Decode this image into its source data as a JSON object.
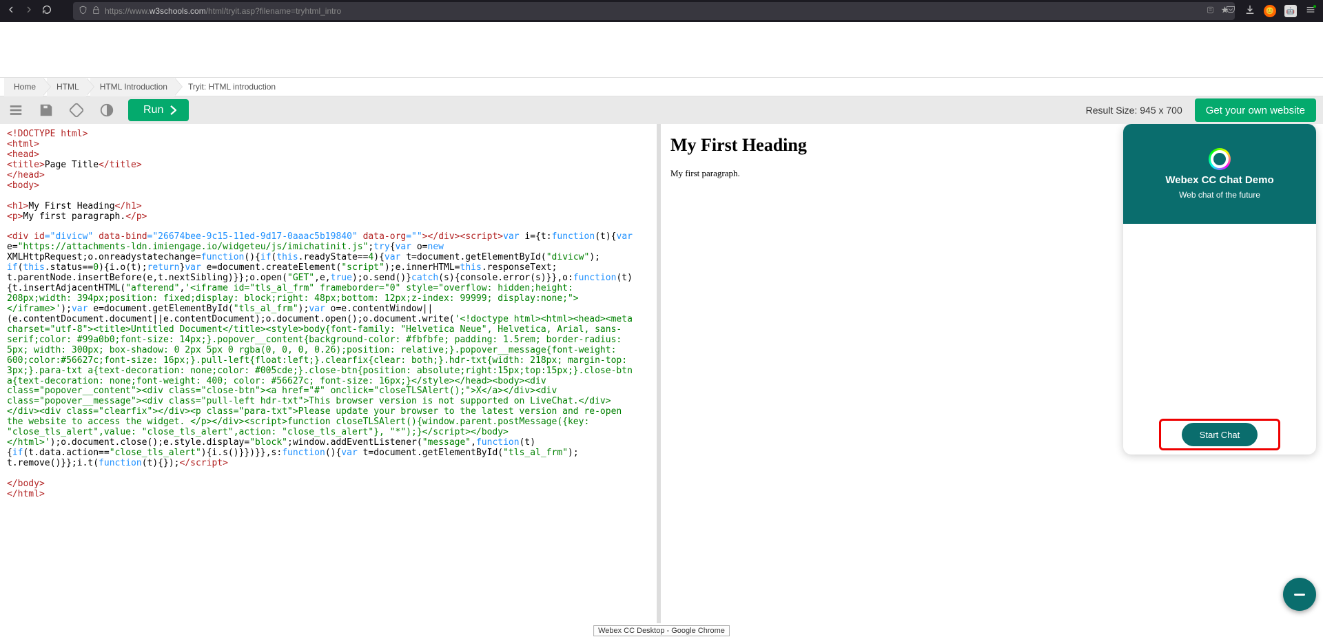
{
  "browser": {
    "url_prefix": "https://www.",
    "url_domain": "w3schools.com",
    "url_path": "/html/tryit.asp?filename=tryhtml_intro"
  },
  "breadcrumbs": {
    "home": "Home",
    "html": "HTML",
    "intro": "HTML Introduction",
    "current": "Tryit: HTML introduction"
  },
  "toolbar": {
    "run": "Run",
    "result_size": "Result Size: 945 x 700",
    "own_site": "Get your own website"
  },
  "preview": {
    "heading": "My First Heading",
    "paragraph": "My first paragraph."
  },
  "chat": {
    "title": "Webex CC Chat Demo",
    "subtitle": "Web chat of the future",
    "start": "Start Chat"
  },
  "bottom_tooltip": "Webex CC Desktop - Google Chrome",
  "code": {
    "l1": "<!DOCTYPE html>",
    "l2": "<html>",
    "l3": "<head>",
    "l4a": "<title>",
    "l4b": "Page Title",
    "l4c": "</title>",
    "l5": "</head>",
    "l6": "<body>",
    "l7a": "<h1>",
    "l7b": "My First Heading",
    "l7c": "</h1>",
    "l8a": "<p>",
    "l8b": "My first paragraph.",
    "l8c": "</p>",
    "div1": "<div id",
    "div1v": "=\"divicw\"",
    "div2": " data-bind",
    "div2v": "=\"26674bee-9c15-11ed-9d17-0aaac5b19840\"",
    "div3": " data-org",
    "div3v": "=\"\"",
    "div4": "></div><script>",
    "div5": "var",
    "div6": " i={t:",
    "div7": "function",
    "div8": "(t){",
    "div9": "var",
    "l10a": "e=",
    "l10b": "\"https://attachments-ldn.imiengage.io/widgeteu/js/imichatinit.js\"",
    "l10c": ";",
    "l10d": "try",
    "l10e": "{",
    "l10f": "var",
    "l10g": " o=",
    "l10h": "new",
    "l11a": "XMLHttpRequest;o.onreadystatechange=",
    "l11b": "function",
    "l11c": "(){",
    "l11d": "if",
    "l11e": "(",
    "l11f": "this",
    "l11g": ".readyState==",
    "l11h": "4",
    "l11i": "){",
    "l11j": "var",
    "l11k": " t=document.getElementById(",
    "l11l": "\"divicw\"",
    "l11m": ");",
    "l12a": "if",
    "l12b": "(",
    "l12c": "this",
    "l12d": ".status==",
    "l12e": "0",
    "l12f": "){i.o(t);",
    "l12g": "return",
    "l12h": "}",
    "l12i": "var",
    "l12j": " e=document.createElement(",
    "l12k": "\"script\"",
    "l12l": ");e.innerHTML=",
    "l12m": "this",
    "l12n": ".responseText;",
    "l13a": "t.parentNode.insertBefore(e,t.nextSibling)}};o.open(",
    "l13b": "\"GET\"",
    "l13c": ",e,",
    "l13d": "true",
    "l13e": ");o.send()}",
    "l13f": "catch",
    "l13g": "(s){console.error(s)}},o:",
    "l13h": "function",
    "l13i": "(t)",
    "l14a": "{t.insertAdjacentHTML(",
    "l14b": "\"afterend\"",
    "l14c": ",",
    "l14d": "'<iframe id=\"tls_al_frm\" frameborder=\"0\" style=\"overflow: hidden;height:",
    "l15": "208px;width: 394px;position: fixed;display: block;right: 48px;bottom: 12px;z-index: 99999; display:none;\">",
    "l16a": "</iframe>'",
    "l16b": ");",
    "l16c": "var",
    "l16d": " e=document.getElementById(",
    "l16e": "\"tls_al_frm\"",
    "l16f": ");",
    "l16g": "var",
    "l16h": " o=e.contentWindow||",
    "l17a": "(e.contentDocument.document||e.contentDocument);o.document.open();o.document.write(",
    "l17b": "'<!doctype html><html><head><meta",
    "l18": "charset=\"utf-8\"><title>Untitled Document</title><style>body{font-family: \"Helvetica Neue\", Helvetica, Arial, sans-",
    "l19": "serif;color: #99a0b0;font-size: 14px;}.popover__content{background-color: #fbfbfe; padding: 1.5rem; border-radius:",
    "l20": "5px; width: 300px; box-shadow: 0 2px 5px 0 rgba(0, 0, 0, 0.26);position: relative;}.popover__message{font-weight:",
    "l21": "600;color:#56627c;font-size: 16px;}.pull-left{float:left;}.clearfix{clear: both;}.hdr-txt{width: 218px; margin-top:",
    "l22": "3px;}.para-txt a{text-decoration: none;color: #005cde;}.close-btn{position: absolute;right:15px;top:15px;}.close-btn",
    "l23": "a{text-decoration: none;font-weight: 400; color: #56627c; font-size: 16px;}</style></head><body><div",
    "l24": "class=\"popover__content\"><div class=\"close-btn\"><a href=\"#\" onclick=\"closeTLSAlert();\">X</a></div><div",
    "l25": "class=\"popover__message\"><div class=\"pull-left hdr-txt\">This browser version is not supported on LiveChat.</div>",
    "l26": "</div><div class=\"clearfix\"></div><p class=\"para-txt\">Please update your browser to the latest version and re-open",
    "l27a": "the website to access the widget. </p></div><script>function closeTLSAlert(){window.parent.postMessage({key:",
    "l28a": "\"close_tls_alert\",value: \"close_tls_alert\",action: \"close_tls_alert\"}, \"*\");}</script></body>",
    "l29a": "</html>'",
    "l29b": ");o.document.close();e.style.display=",
    "l29c": "\"block\"",
    "l29d": ";window.addEventListener(",
    "l29e": "\"message\"",
    "l29f": ",",
    "l29g": "function",
    "l29h": "(t)",
    "l30a": "{",
    "l30b": "if",
    "l30c": "(t.data.action==",
    "l30d": "\"close_tls_alert\"",
    "l30e": "){i.s()}})}},s:",
    "l30f": "function",
    "l30g": "(){",
    "l30h": "var",
    "l30i": " t=document.getElementById(",
    "l30j": "\"tls_al_frm\"",
    "l30k": ");",
    "l31a": "t.remove()}};i.t(",
    "l31b": "function",
    "l31c": "(t){});",
    "l31d": "</script>",
    "l32": "</body>",
    "l33": "</html>"
  }
}
